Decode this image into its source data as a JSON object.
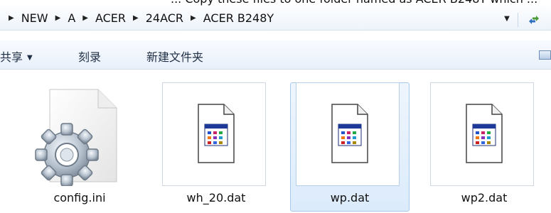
{
  "instruction_fragment": "... Copy these files to one folder named as ACER B248Y which ...",
  "breadcrumb": [
    "NEW",
    "A",
    "ACER",
    "24ACR",
    "ACER B248Y"
  ],
  "toolbar": {
    "share_label": "共享",
    "burn_label": "刻录",
    "new_folder_label": "新建文件夹"
  },
  "files": [
    {
      "name": "config.ini",
      "icon": "config-settings-icon",
      "selected": false
    },
    {
      "name": "wh_20.dat",
      "icon": "dat-file-icon",
      "selected": false
    },
    {
      "name": "wp.dat",
      "icon": "dat-file-icon",
      "selected": true
    },
    {
      "name": "wp2.dat",
      "icon": "dat-file-icon",
      "selected": false
    }
  ],
  "colors": {
    "selection_fill": "#dcebfb",
    "selection_border": "#a8c9ee",
    "toolbar_text": "#1f2f45"
  }
}
